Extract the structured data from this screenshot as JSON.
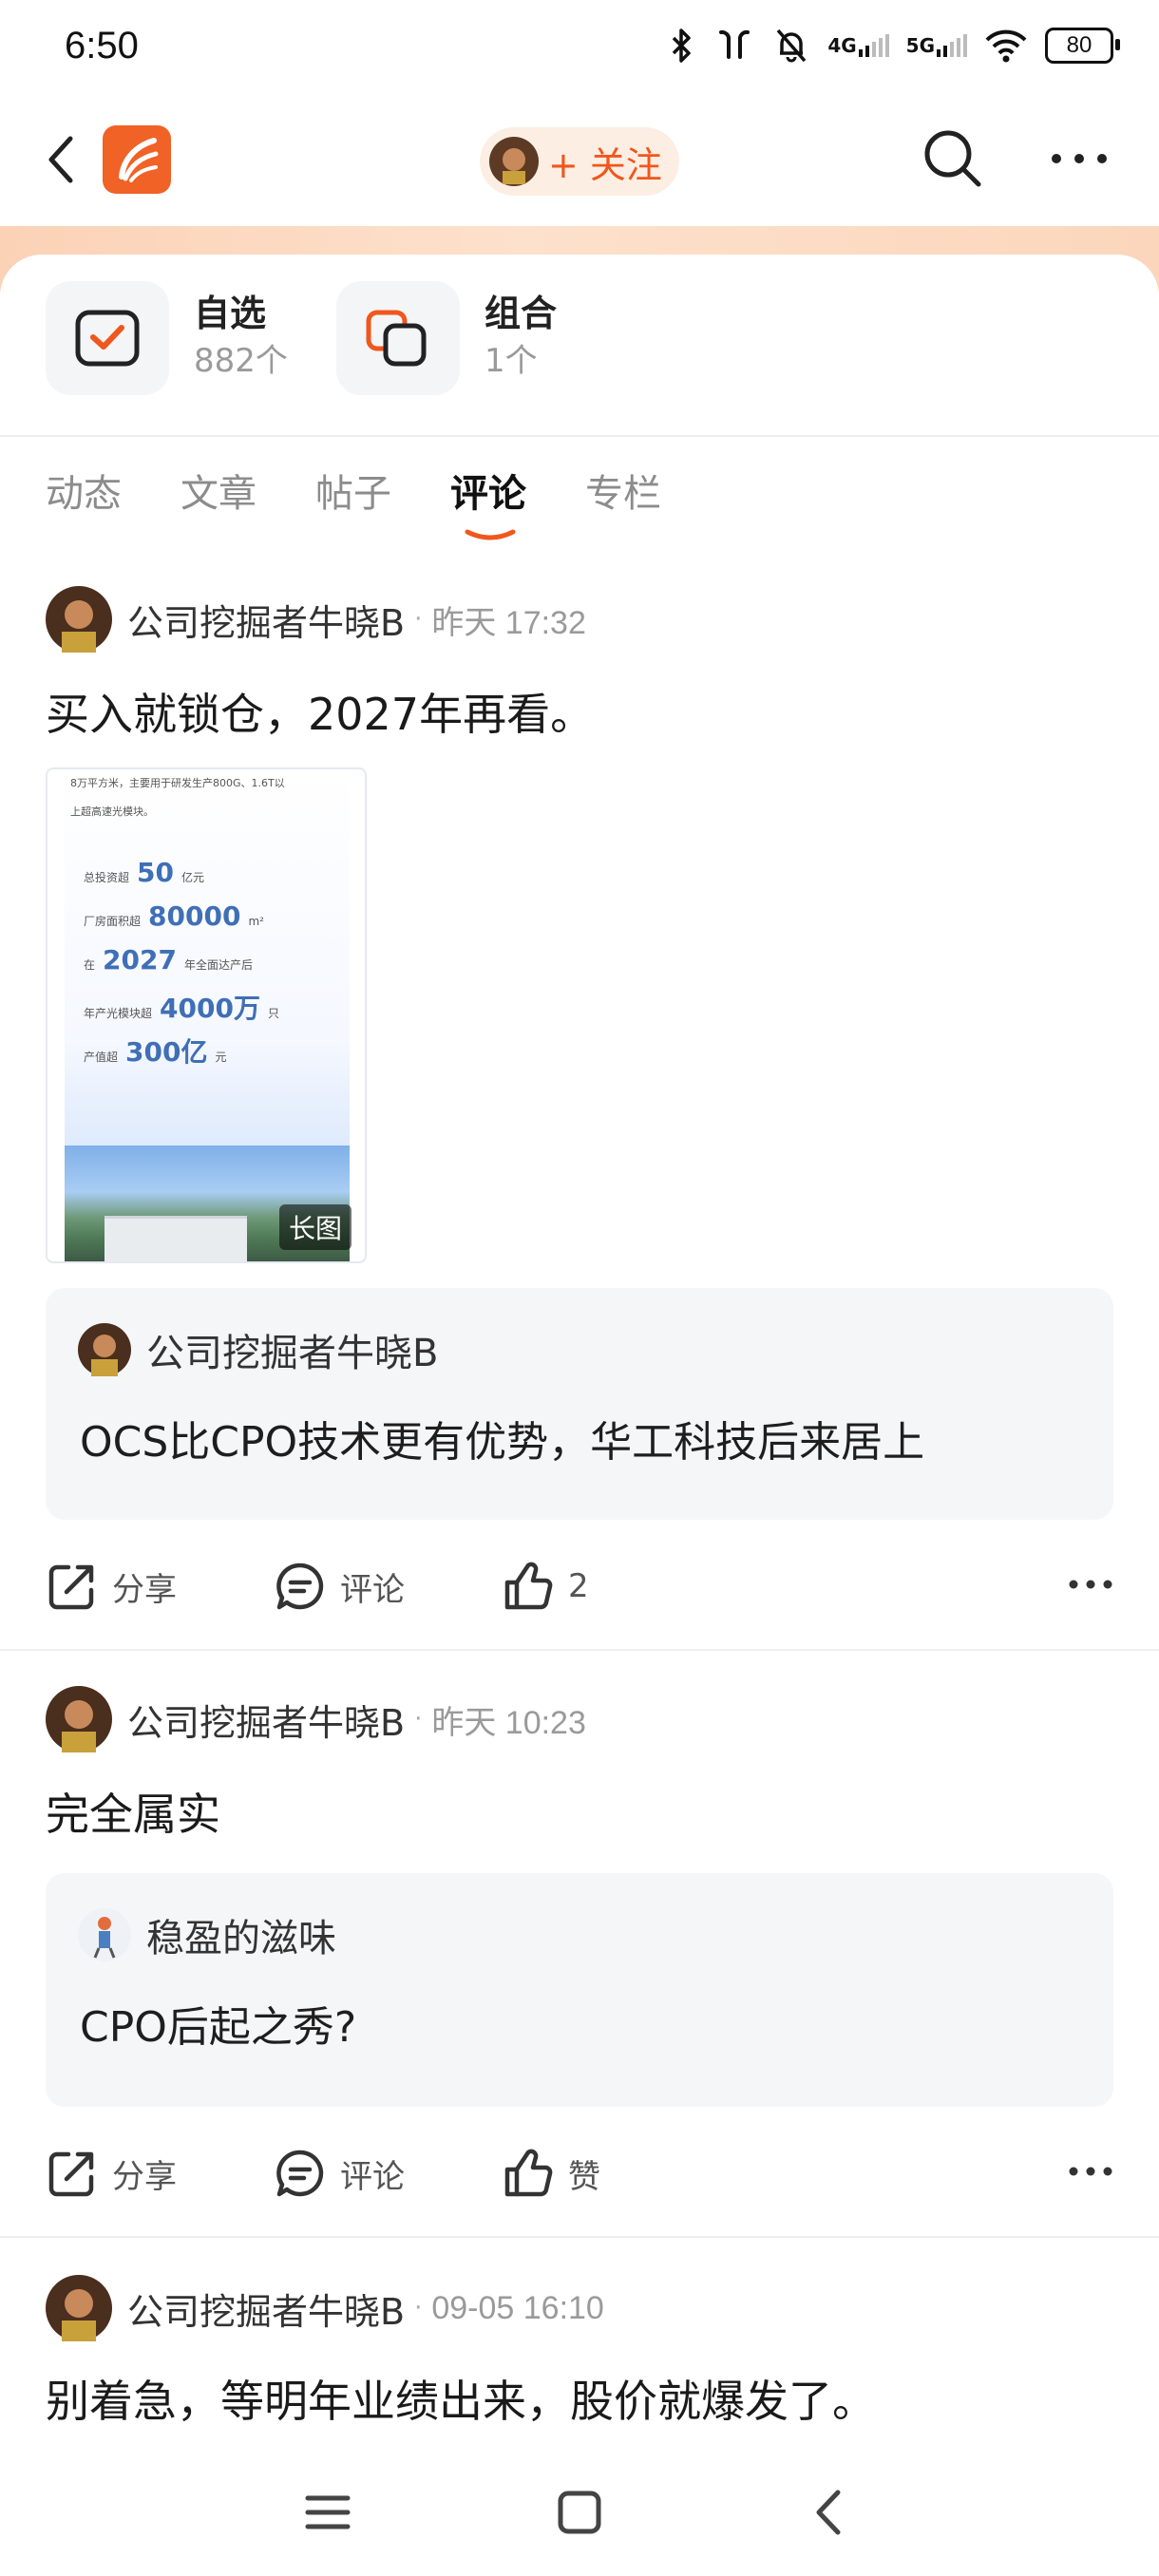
{
  "status_bar": {
    "time": "6:50",
    "net1": "4G",
    "net2": "5G",
    "battery": "80"
  },
  "header": {
    "follow_label": "+ 关注"
  },
  "portfolio": [
    {
      "title": "自选",
      "count": "882个"
    },
    {
      "title": "组合",
      "count": "1个"
    }
  ],
  "tabs": [
    {
      "label": "动态",
      "active": false
    },
    {
      "label": "文章",
      "active": false
    },
    {
      "label": "帖子",
      "active": false
    },
    {
      "label": "评论",
      "active": true
    },
    {
      "label": "专栏",
      "active": false
    }
  ],
  "posts": [
    {
      "author": "公司挖掘者牛晓B",
      "time": "昨天 17:32",
      "text": "买入就锁仓，2027年再看。",
      "image": {
        "badge": "长图",
        "header_line1": "8万平方米，主要用于研发生产800G、1.6T以",
        "header_line2": "上超高速光模块。",
        "rows": [
          {
            "pre": "总投资超",
            "big": "50",
            "post": "亿元"
          },
          {
            "pre": "厂房面积超",
            "big": "80000",
            "post": "m²"
          },
          {
            "pre": "在",
            "big": "2027",
            "post": "年全面达产后"
          },
          {
            "pre": "年产光模块超",
            "big": "4000万",
            "post": "只"
          },
          {
            "pre": "产值超",
            "big": "300亿",
            "post": "元"
          }
        ]
      },
      "quote": {
        "author": "公司挖掘者牛晓B",
        "text": "OCS比CPO技术更有优势，华工科技后来居上"
      },
      "actions": {
        "share": "分享",
        "comment": "评论",
        "like": "2"
      }
    },
    {
      "author": "公司挖掘者牛晓B",
      "time": "昨天 10:23",
      "text": "完全属实",
      "quote": {
        "author": "稳盈的滋味",
        "text": "CPO后起之秀?"
      },
      "actions": {
        "share": "分享",
        "comment": "评论",
        "like": "赞"
      }
    },
    {
      "author": "公司挖掘者牛晓B",
      "time": "09-05 16:10",
      "text": "别着急，等明年业绩出来，股价就爆发了。"
    }
  ],
  "colors": {
    "accent": "#f0571c",
    "logo": "#f06225",
    "quote_bg": "#f5f6f8"
  }
}
